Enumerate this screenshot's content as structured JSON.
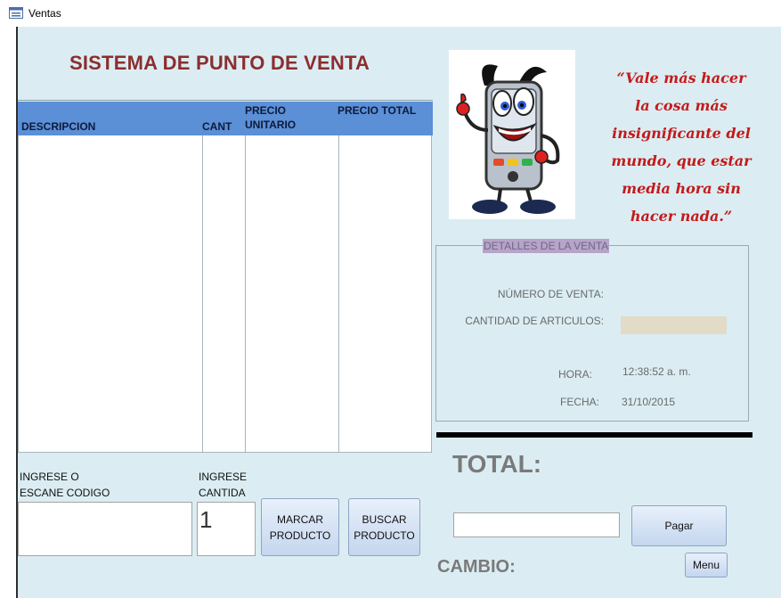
{
  "window": {
    "title": "Ventas",
    "icon": "form-icon"
  },
  "form": {
    "heading": "SISTEMA DE PUNTO DE VENTA",
    "grid": {
      "columns": [
        "DESCRIPCION",
        "CANT",
        "PRECIO\nUNITARIO",
        "PRECIO TOTAL"
      ],
      "rows": []
    },
    "code_label": "INGRESE O\nESCANE CODIGO",
    "code_value": "",
    "qty_label": "INGRESE\nCANTIDA",
    "qty_value": "1",
    "mark_button": "MARCAR\nPRODUCTO",
    "search_button": "BUSCAR\nPRODUCTO",
    "logo": "smartphone-mascot-icon",
    "quote": "“Vale más hacer\nla cosa más\ninsignificante del\nmundo, que estar\nmedia hora sin\nhacer nada.”",
    "details": {
      "legend": "DETALLES DE LA VENTA",
      "sale_number_label": "NÚMERO DE VENTA:",
      "sale_number_value": "",
      "item_count_label": "CANTIDAD DE ARTICULOS:",
      "item_count_value": "",
      "time_label": "HORA:",
      "time_value": "12:38:52 a. m.",
      "date_label": "FECHA:",
      "date_value": "31/10/2015"
    },
    "total_label": "TOTAL:",
    "payment_value": "",
    "pay_button": "Pagar",
    "change_label": "CAMBIO:",
    "menu_button": "Menu"
  },
  "colors": {
    "background": "#dbedf3",
    "grid_header": "#5b8fd6",
    "heading": "#8b2e2e",
    "quote": "#c41a1a",
    "legend_bg": "#b8a3c9"
  }
}
